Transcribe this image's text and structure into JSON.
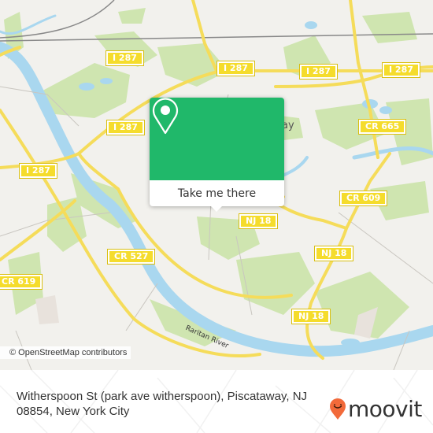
{
  "map": {
    "road_shields": [
      {
        "label": "I 287",
        "id": "i287-west-top"
      },
      {
        "label": "I 287",
        "id": "i287-center"
      },
      {
        "label": "I 287",
        "id": "i287-east-a"
      },
      {
        "label": "I 287",
        "id": "i287-east-b"
      },
      {
        "label": "I 287",
        "id": "i287-west"
      },
      {
        "label": "I 287",
        "id": "i287-far-west"
      },
      {
        "label": "CR 665",
        "id": "cr665"
      },
      {
        "label": "CR 609",
        "id": "cr609"
      },
      {
        "label": "NJ 18",
        "id": "nj18-a"
      },
      {
        "label": "NJ 18",
        "id": "nj18-b"
      },
      {
        "label": "NJ 18",
        "id": "nj18-c"
      },
      {
        "label": "CR 527",
        "id": "cr527"
      },
      {
        "label": "CR 619",
        "id": "cr619"
      }
    ],
    "place_label_fragment": "ay",
    "river_label": "Raritan River",
    "attribution": "© OpenStreetMap contributors",
    "colors": {
      "land": "#f2f1ed",
      "park": "#cfe5b0",
      "water": "#a9d7ef",
      "road": "#f5dc5a",
      "shield": "#f5dc2c"
    }
  },
  "popup": {
    "icon": "location-pin-icon",
    "button_label": "Take me there",
    "accent": "#20b86a"
  },
  "footer": {
    "address": "Witherspoon St (park ave witherspoon), Piscataway, NJ 08854, New York City",
    "brand": "moovit",
    "brand_color": "#f26a3a"
  }
}
